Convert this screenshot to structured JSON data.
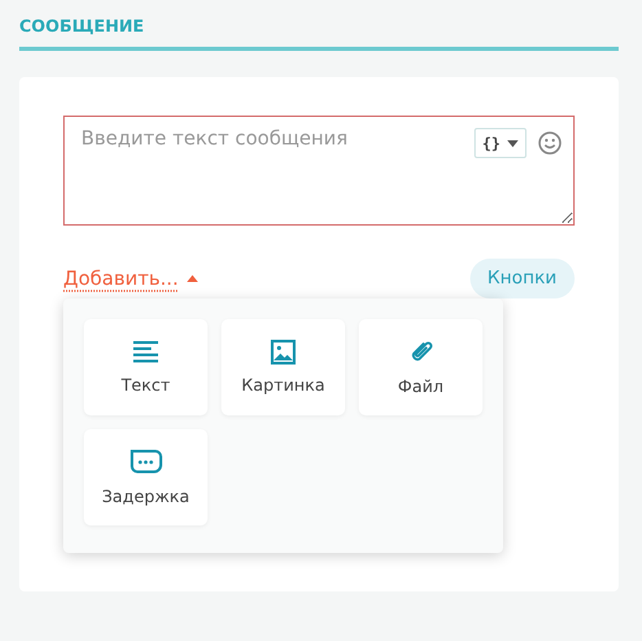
{
  "section": {
    "title": "СООБЩЕНИЕ"
  },
  "message_field": {
    "placeholder": "Введите текст сообщения",
    "error": true,
    "variable_button": "{}"
  },
  "add_menu": {
    "label": "Добавить...",
    "expanded": true,
    "items": [
      {
        "kind": "text",
        "label": "Текст"
      },
      {
        "kind": "image",
        "label": "Картинка"
      },
      {
        "kind": "file",
        "label": "Файл"
      },
      {
        "kind": "delay",
        "label": "Задержка"
      }
    ]
  },
  "buttons_chip": "Кнопки"
}
